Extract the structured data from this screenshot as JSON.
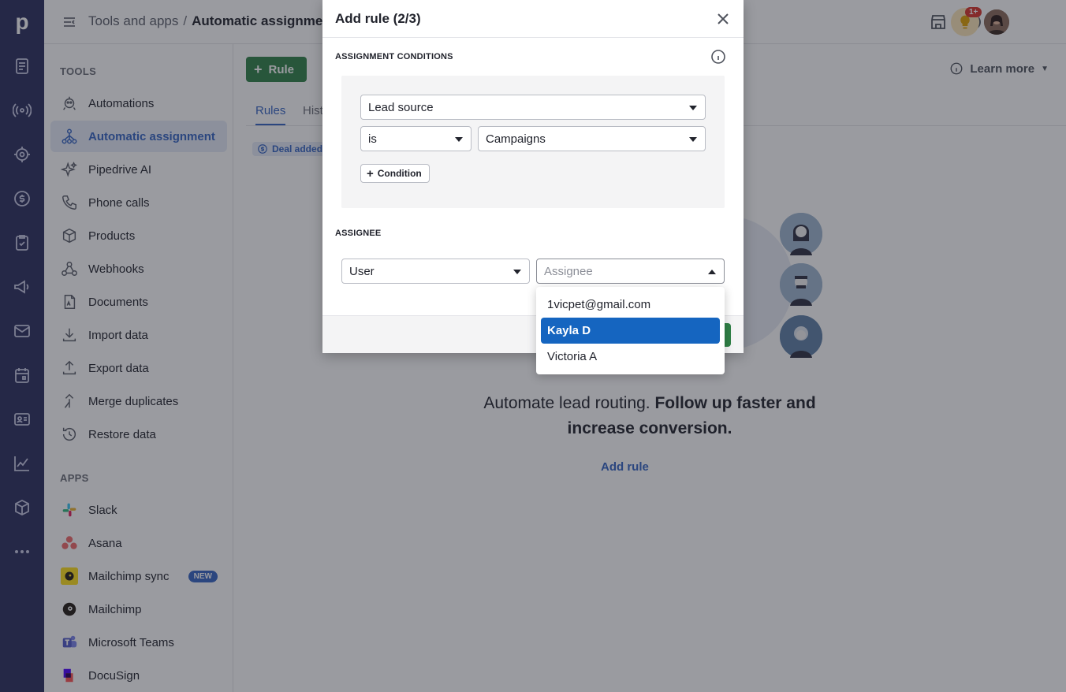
{
  "topbar": {
    "crumb_parent": "Tools and apps",
    "crumb_separator": "/",
    "crumb_current": "Automatic assignment",
    "notification_count": "1+"
  },
  "sidebar": {
    "tools_title": "TOOLS",
    "apps_title": "APPS",
    "tools": [
      {
        "label": "Automations",
        "icon": "robot-icon"
      },
      {
        "label": "Automatic assignment",
        "icon": "assignment-icon"
      },
      {
        "label": "Pipedrive AI",
        "icon": "sparkle-icon"
      },
      {
        "label": "Phone calls",
        "icon": "phone-icon"
      },
      {
        "label": "Products",
        "icon": "box-icon"
      },
      {
        "label": "Webhooks",
        "icon": "webhook-icon"
      },
      {
        "label": "Documents",
        "icon": "document-icon"
      },
      {
        "label": "Import data",
        "icon": "import-icon"
      },
      {
        "label": "Export data",
        "icon": "export-icon"
      },
      {
        "label": "Merge duplicates",
        "icon": "merge-icon"
      },
      {
        "label": "Restore data",
        "icon": "restore-icon"
      }
    ],
    "apps": [
      {
        "label": "Slack",
        "icon": "slack-icon"
      },
      {
        "label": "Asana",
        "icon": "asana-icon"
      },
      {
        "label": "Mailchimp sync",
        "icon": "mailchimp-icon",
        "badge": "NEW"
      },
      {
        "label": "Mailchimp",
        "icon": "mailchimp-icon"
      },
      {
        "label": "Microsoft Teams",
        "icon": "teams-icon"
      },
      {
        "label": "DocuSign",
        "icon": "docusign-icon"
      }
    ]
  },
  "main": {
    "rule_button": "Rule",
    "tabs": [
      "Rules",
      "Hist"
    ],
    "deal_tag": "Deal added",
    "learn_more": "Learn more",
    "empty_normal": "Automate lead routing. ",
    "empty_bold": "Follow up faster and increase conversion.",
    "add_rule_link": "Add rule"
  },
  "modal": {
    "title": "Add rule (2/3)",
    "conditions_title": "ASSIGNMENT CONDITIONS",
    "field_select": "Lead source",
    "operator_select": "is",
    "value_select": "Campaigns",
    "condition_button": "Condition",
    "assignee_title": "ASSIGNEE",
    "assignee_type": "User",
    "assignee_placeholder": "Assignee"
  },
  "dropdown": {
    "options": [
      "1vicpet@gmail.com",
      "Kayla D",
      "Victoria A"
    ],
    "selected_index": 1
  },
  "colors": {
    "rail": "#2b2e5e",
    "primary_green": "#308147",
    "accent_blue": "#3565c4",
    "selected_option": "#1565c0"
  }
}
